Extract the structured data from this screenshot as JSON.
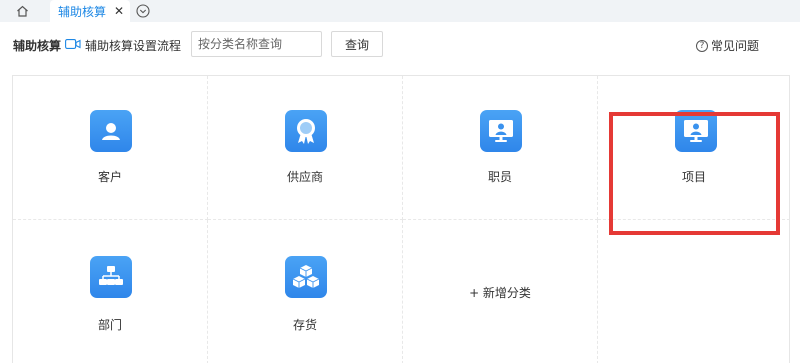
{
  "tabs": {
    "home_icon": "home-icon",
    "active_label": "辅助核算",
    "close_label": "✕",
    "more_icon": "chevron-down-circle-icon"
  },
  "toolbar": {
    "title": "辅助核算",
    "flow_label": "辅助核算设置流程",
    "search_placeholder": "按分类名称查询",
    "search_value": "",
    "search_button": "查询",
    "faq_label": "常见问题",
    "faq_icon_glyph": "?"
  },
  "categories": [
    {
      "label": "客户",
      "icon": "person-icon"
    },
    {
      "label": "供应商",
      "icon": "badge-icon"
    },
    {
      "label": "职员",
      "icon": "monitor-person-icon"
    },
    {
      "label": "项目",
      "icon": "monitor-person-icon"
    },
    {
      "label": "部门",
      "icon": "org-chart-icon"
    },
    {
      "label": "存货",
      "icon": "boxes-icon"
    }
  ],
  "add_category_label": "+ 新增分类",
  "colors": {
    "accent": "#1e88e5",
    "icon_bg": "#3a92ee",
    "highlight": "#e53935"
  }
}
